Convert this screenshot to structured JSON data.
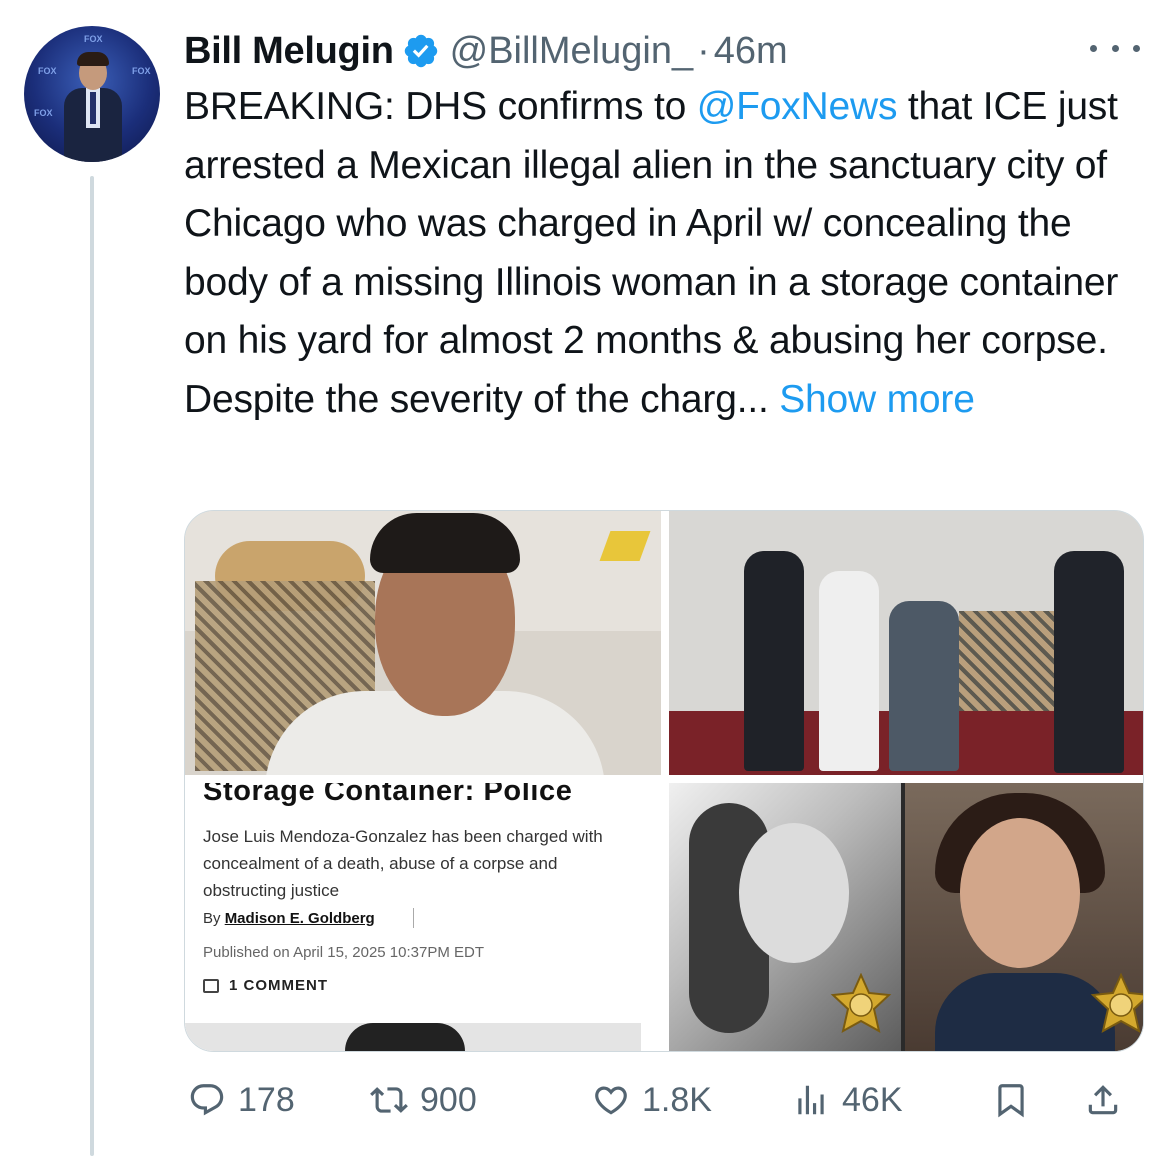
{
  "author": {
    "name": "Bill Melugin",
    "handle": "@BillMelugin_",
    "separator": "·",
    "time": "46m"
  },
  "tweet": {
    "text_before_mention": "BREAKING: DHS confirms to ",
    "mention": "@FoxNews",
    "text_after_mention": " that ICE just arrested a Mexican illegal alien in the sanctuary city of Chicago who was charged in April w/ concealing the body of a missing Illinois woman in a storage container on his yard for almost 2 months & abusing her corpse. Despite the severity of the charg... ",
    "show_more": "Show more"
  },
  "article_card": {
    "title": "Storage Container: Police",
    "description": "Jose Luis Mendoza-Gonzalez has been charged with concealment of a death, abuse of a corpse and obstructing justice",
    "by_label": "By ",
    "author": "Madison E. Goldberg",
    "published": "Published on April 15, 2025 10:37PM EDT",
    "comments": "1 COMMENT"
  },
  "actions": {
    "replies": "178",
    "reposts": "900",
    "likes": "1.8K",
    "views": "46K"
  },
  "avatar_logo_text": [
    "FOX",
    "FOX",
    "FOX",
    "FOX"
  ],
  "colors": {
    "accent": "#1d9bf0",
    "text": "#0f1419",
    "secondary": "#536471"
  },
  "icons": [
    "verified-badge-icon",
    "more-options-icon",
    "reply-icon",
    "repost-icon",
    "like-icon",
    "views-icon",
    "bookmark-icon",
    "share-icon"
  ]
}
